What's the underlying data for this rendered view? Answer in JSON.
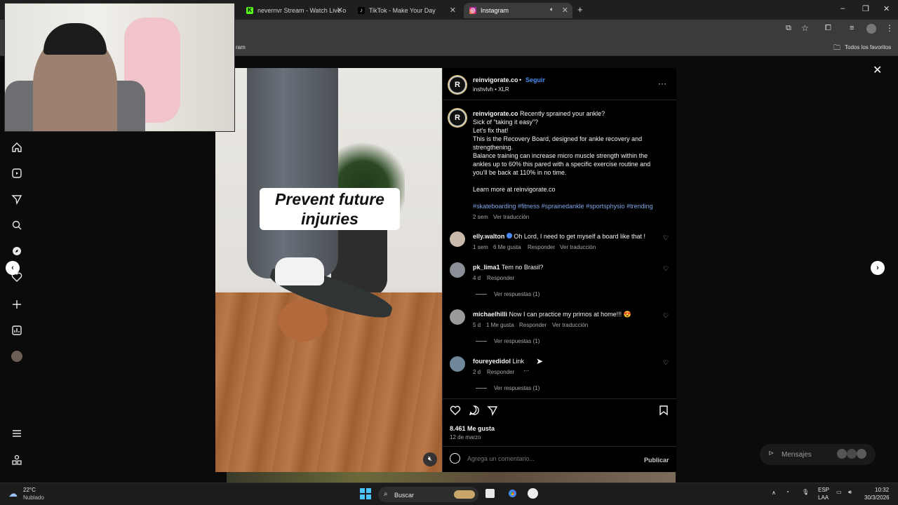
{
  "tabs": [
    {
      "label": "nevernvr Stream - Watch Live o",
      "icon": "kick-icon"
    },
    {
      "label": "TikTok - Make Your Day",
      "icon": "tiktok-icon"
    },
    {
      "label": "Instagram",
      "icon": "instagram-icon"
    }
  ],
  "bookmarks": {
    "partial": "ram",
    "all_bookmarks": "Todos los favoritos"
  },
  "video": {
    "caption_line1": "Prevent future",
    "caption_line2": "injuries"
  },
  "post": {
    "username": "reinvigorate.co",
    "dot": "•",
    "follow": "Seguir",
    "audio": "inshvlvh • XLR",
    "caption": {
      "author": "reinvigorate.co",
      "line1": "Recently sprained your ankle?",
      "line2": "Sick of “taking it easy”?",
      "line3": "Let’s fix that!",
      "line4": "This is the Recovery Board, designed for ankle recovery and",
      "line5": "strengthening.",
      "line6": "Balance training can increase micro muscle strength within the",
      "line7": "ankles up to 60% this pared with a specific exercise routine and",
      "line8": "you’ll be back at 110% in no time.",
      "line9": "Learn more at reinvigorate.co",
      "hashtags": "#skateboarding #fitness #sprainedankle #sportsphysio #trending",
      "time": "2 sem",
      "translate": "Ver traducción"
    },
    "comments": [
      {
        "user": "elly.walton",
        "text": "Oh Lord, I need to get myself a board like that !",
        "time": "1 sem",
        "likes": "6 Me gusta",
        "reply": "Responder",
        "translate": "Ver traducción"
      },
      {
        "user": "pk_lima1",
        "text": "Tem no Brasil?",
        "time": "4 d",
        "reply": "Responder",
        "replies": "Ver respuestas (1)"
      },
      {
        "user": "michaelhilli",
        "text": "Now I can practice my primos at home!!! 😍",
        "time": "5 d",
        "likes": "1 Me gusta",
        "reply": "Responder",
        "translate": "Ver traducción",
        "replies": "Ver respuestas (1)"
      },
      {
        "user": "foureyedidol",
        "text": "Link",
        "time": "2 d",
        "reply": "Responder",
        "more": "···",
        "replies": "Ver respuestas (1)"
      }
    ],
    "likes_count": "8.461 Me gusta",
    "date": "12 de marzo",
    "comment_placeholder": "Agrega un comentario...",
    "publish": "Publicar"
  },
  "messages": {
    "label": "Mensajes"
  },
  "taskbar": {
    "weather_temp": "22°C",
    "weather_desc": "Nublado",
    "search": "Buscar",
    "lang1": "ESP",
    "lang2": "LAA",
    "time": "10:32",
    "date": "30/3/2026"
  },
  "colors": {
    "accent_link": "#7fa7e8",
    "follow_blue": "#4a8cf0",
    "panel_bg": "#000000"
  }
}
